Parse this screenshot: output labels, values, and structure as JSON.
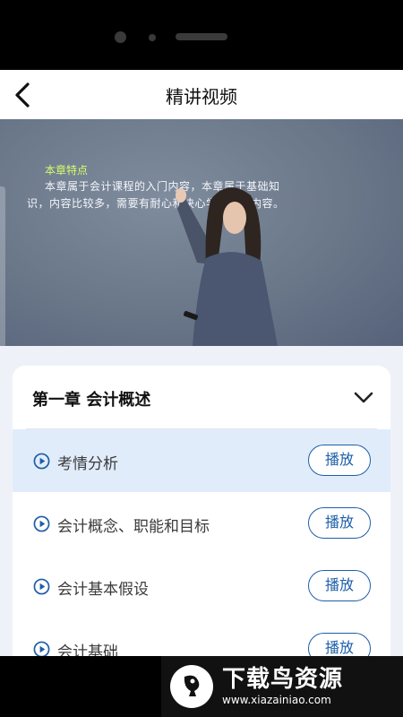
{
  "header": {
    "title": "精讲视频",
    "back_icon": "back-arrow-icon"
  },
  "video": {
    "overlay_title": "本章特点",
    "overlay_line1": "本章属于会计课程的入门内容，本章属于基础知",
    "overlay_line2": "识，内容比较多，需要有耐心和决心学好本章内容。"
  },
  "chapter": {
    "title": "第一章 会计概述",
    "toggle_icon": "chevron-down-icon",
    "lessons": [
      {
        "title": "考情分析",
        "button": "播放",
        "active": true
      },
      {
        "title": "会计概念、职能和目标",
        "button": "播放",
        "active": false
      },
      {
        "title": "会计基本假设",
        "button": "播放",
        "active": false
      },
      {
        "title": "会计基础",
        "button": "播放",
        "active": false
      }
    ]
  },
  "watermark": {
    "title": "下载鸟资源",
    "url": "www.xiazainiao.com"
  },
  "colors": {
    "accent": "#1e5ea8",
    "active_row": "#e1ecfa",
    "page_bg": "#eef2f8",
    "overlay_title": "#d6ff6a"
  }
}
